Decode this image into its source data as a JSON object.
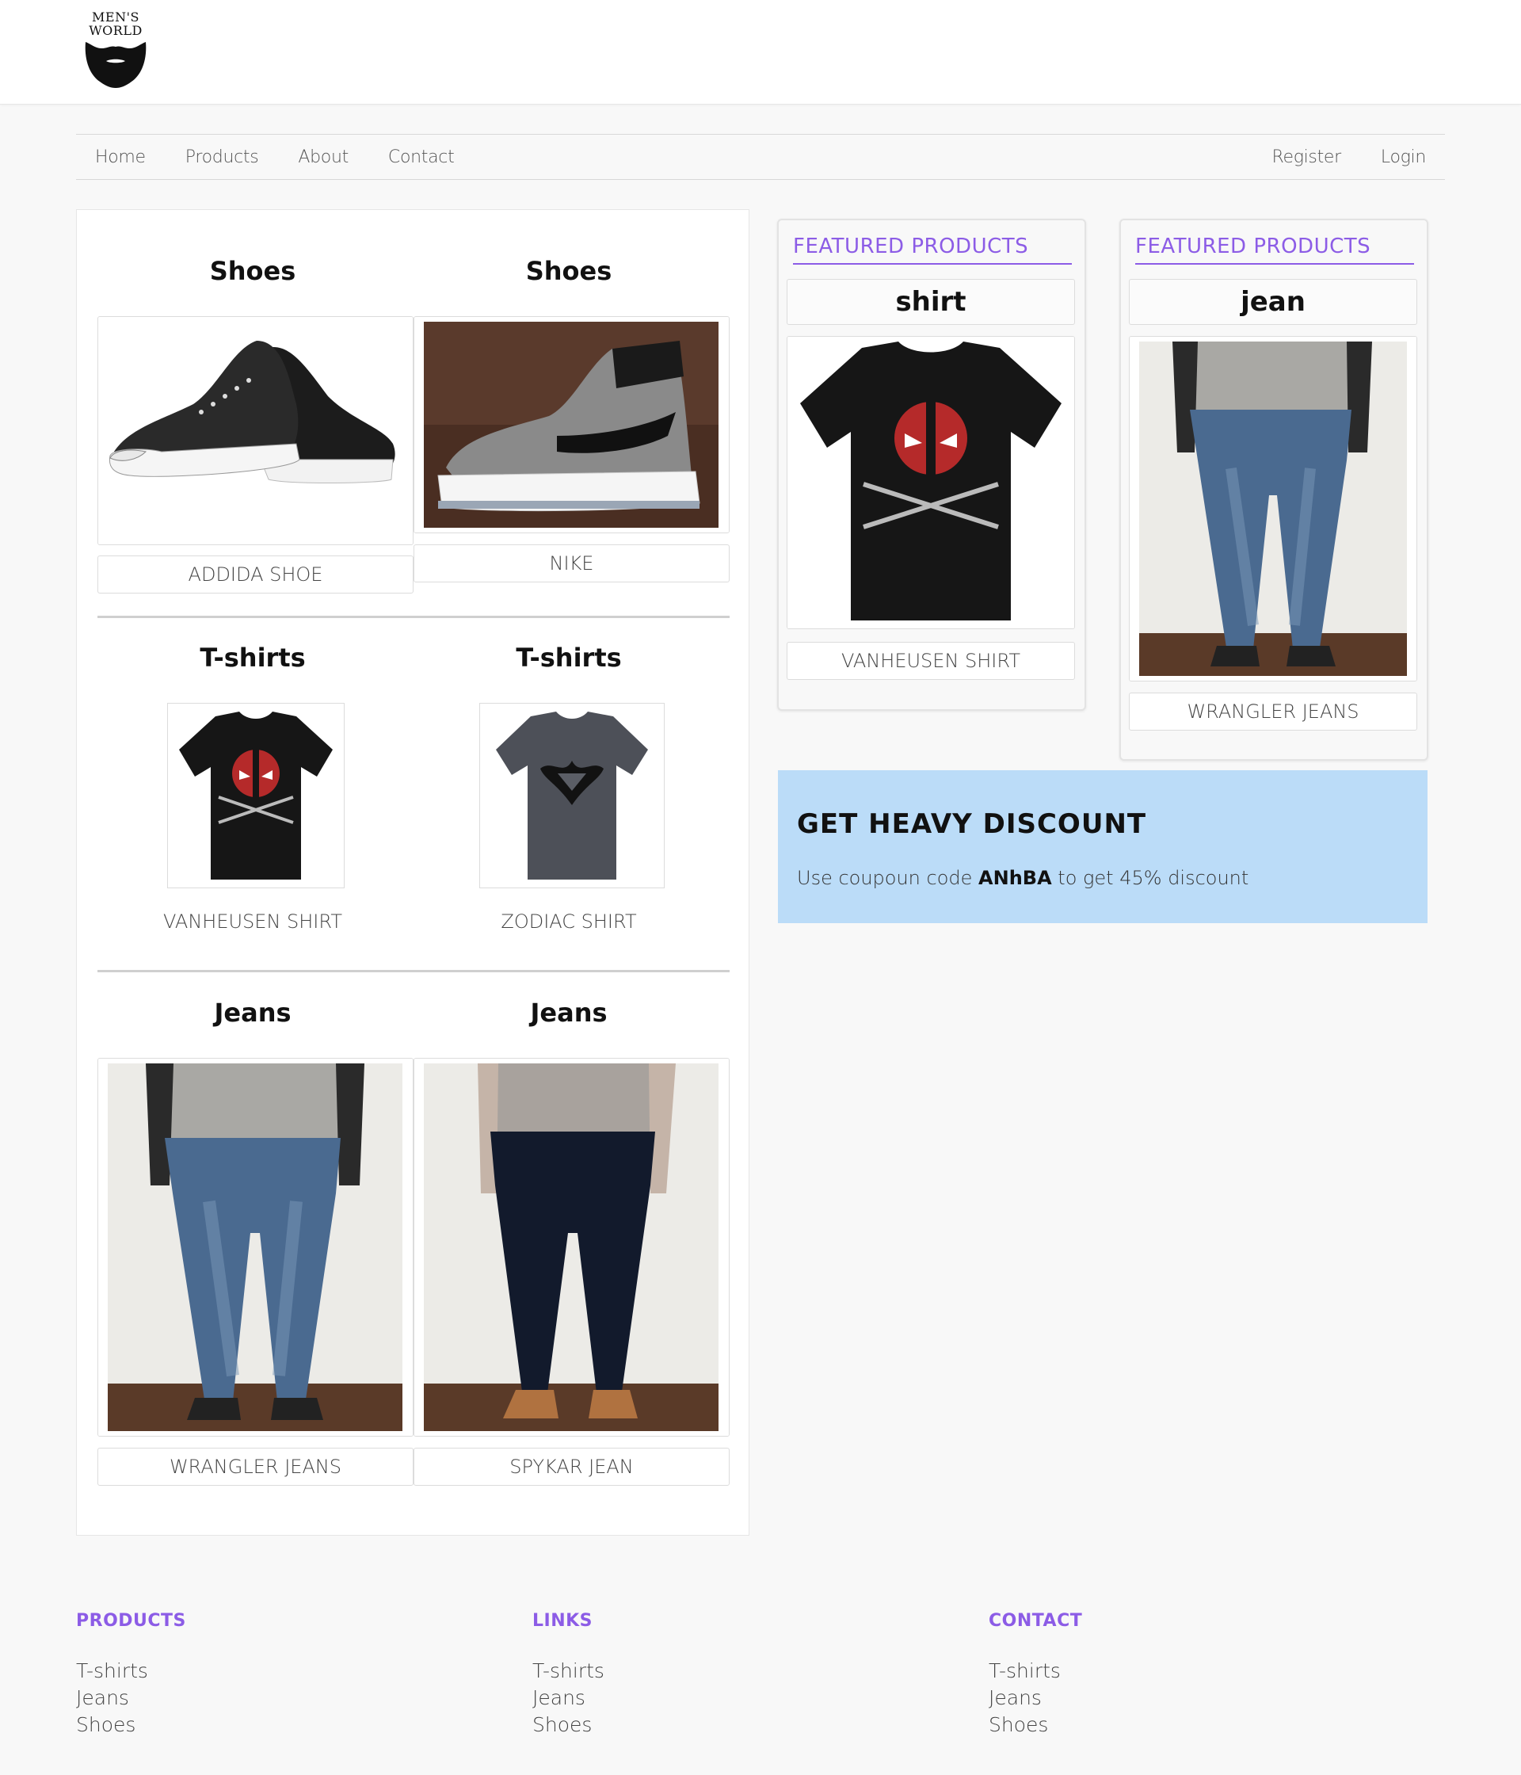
{
  "brand": {
    "logo_line1": "MEN'S",
    "logo_line2": "WORLD"
  },
  "nav": {
    "left": [
      "Home",
      "Products",
      "About",
      "Contact"
    ],
    "right": [
      "Register",
      "Login"
    ]
  },
  "catalog": {
    "rows": [
      {
        "items": [
          {
            "category": "Shoes",
            "name": "ADDIDA SHOE",
            "image": "sneaker-image"
          },
          {
            "category": "Shoes",
            "name": "NIKE",
            "image": "hightop-image"
          }
        ]
      },
      {
        "items": [
          {
            "category": "T-shirts",
            "name": "VANHEUSEN SHIRT",
            "image": "deadpool-tshirt-image"
          },
          {
            "category": "T-shirts",
            "name": "ZODIAC SHIRT",
            "image": "batman-superman-tshirt-image"
          }
        ]
      },
      {
        "items": [
          {
            "category": "Jeans",
            "name": "WRANGLER JEANS",
            "image": "blue-jeans-image"
          },
          {
            "category": "Jeans",
            "name": "SPYKAR JEAN",
            "image": "dark-jeans-image"
          }
        ]
      }
    ]
  },
  "featured": [
    {
      "heading": "FEATURED PRODUCTS",
      "title": "shirt",
      "name": "VANHEUSEN SHIRT"
    },
    {
      "heading": "FEATURED PRODUCTS",
      "title": "jean",
      "name": "WRANGLER JEANS"
    }
  ],
  "discount": {
    "title": "GET HEAVY DISCOUNT",
    "text_before": "Use coupoun code ",
    "code": "ANhBA",
    "text_after": " to get 45% discount"
  },
  "footer": [
    {
      "title": "PRODUCTS",
      "links": [
        "T-shirts",
        "Jeans",
        "Shoes"
      ]
    },
    {
      "title": "LINKS",
      "links": [
        "T-shirts",
        "Jeans",
        "Shoes"
      ]
    },
    {
      "title": "CONTACT",
      "links": [
        "T-shirts",
        "Jeans",
        "Shoes"
      ]
    }
  ],
  "colors": {
    "accent": "#8c5ce6",
    "discount_bg": "#bbdcf8",
    "page_bg": "#f8f8f8"
  }
}
